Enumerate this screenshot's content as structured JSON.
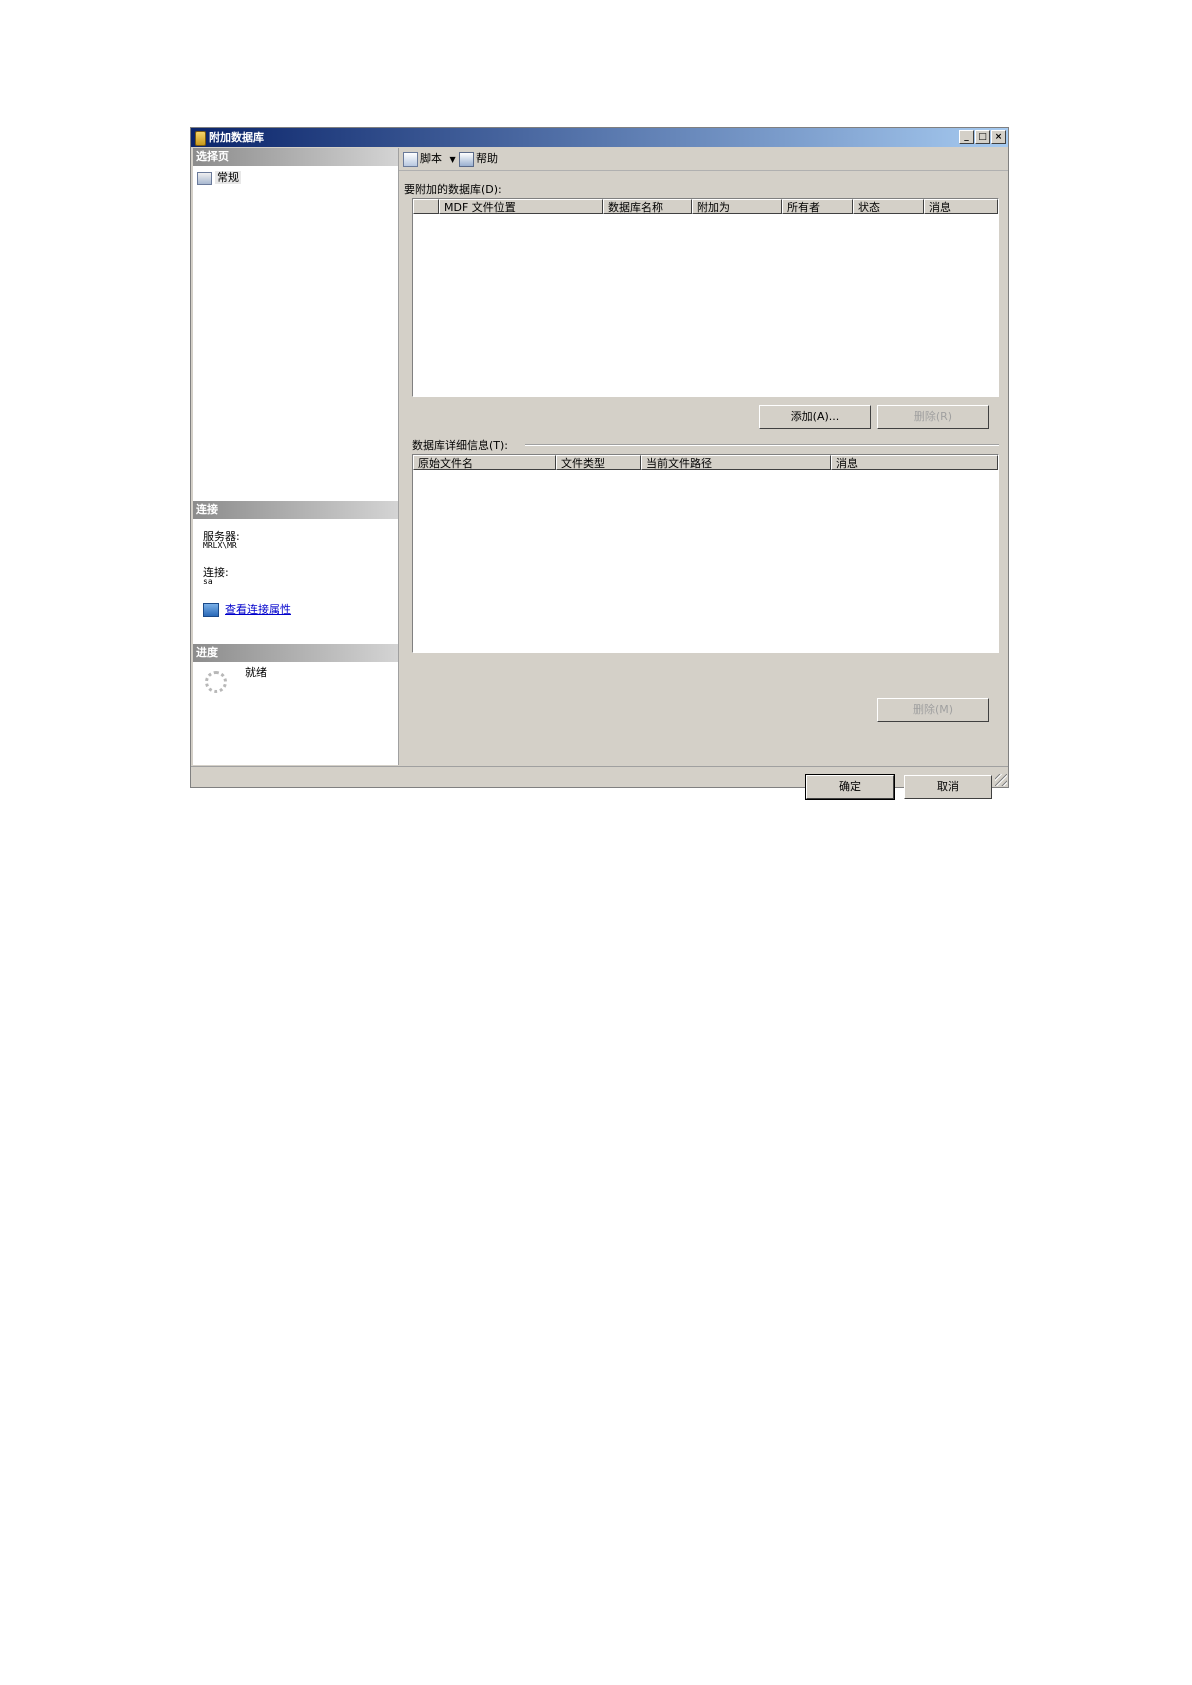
{
  "window": {
    "title": "附加数据库",
    "min_label": "_",
    "max_label": "□",
    "close_label": "×"
  },
  "left": {
    "select_page_header": "选择页",
    "nav_items": [
      {
        "label": "常规"
      }
    ],
    "connection_header": "连接",
    "server_label": "服务器:",
    "server_value": "MRLX\\MR",
    "connection_label": "连接:",
    "connection_value": "sa",
    "view_conn_link": "查看连接属性",
    "progress_header": "进度",
    "progress_status": "就绪"
  },
  "toolbar": {
    "script_label": "脚本",
    "help_label": "帮助"
  },
  "attach": {
    "label": "要附加的数据库(D):",
    "columns": [
      "",
      "MDF 文件位置",
      "数据库名称",
      "附加为",
      "所有者",
      "状态",
      "消息"
    ],
    "add_button": "添加(A)...",
    "remove_button": "删除(R)"
  },
  "details": {
    "label": "数据库详细信息(T):",
    "columns": [
      "原始文件名",
      "文件类型",
      "当前文件路径",
      "消息"
    ],
    "remove_button": "删除(M)"
  },
  "footer": {
    "ok_button": "确定",
    "cancel_button": "取消"
  },
  "colors": {
    "title_start": "#0a246a",
    "title_end": "#a6caf0",
    "dialog_bg": "#d4d0c8",
    "link": "#0000cc"
  }
}
